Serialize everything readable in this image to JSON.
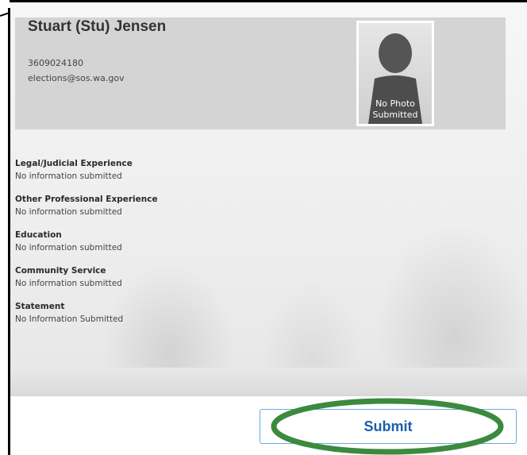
{
  "candidate": {
    "name": "Stuart (Stu) Jensen",
    "phone": "3609024180",
    "email": "elections@sos.wa.gov",
    "photo_caption_line1": "No Photo",
    "photo_caption_line2": "Submitted"
  },
  "sections": [
    {
      "title": "Legal/Judicial Experience",
      "value": "No information submitted"
    },
    {
      "title": "Other Professional Experience",
      "value": "No information submitted"
    },
    {
      "title": "Education",
      "value": "No information submitted"
    },
    {
      "title": "Community Service",
      "value": "No information submitted"
    },
    {
      "title": "Statement",
      "value": "No Information Submitted"
    }
  ],
  "footer": {
    "submit_label": "Submit"
  },
  "colors": {
    "header_bg": "#d4d4d4",
    "button_text": "#1c5fa8",
    "button_border": "#6aa9e0",
    "highlight_ellipse": "#3b8a3e"
  },
  "icons": {
    "photo_placeholder": "person-silhouette-icon"
  }
}
